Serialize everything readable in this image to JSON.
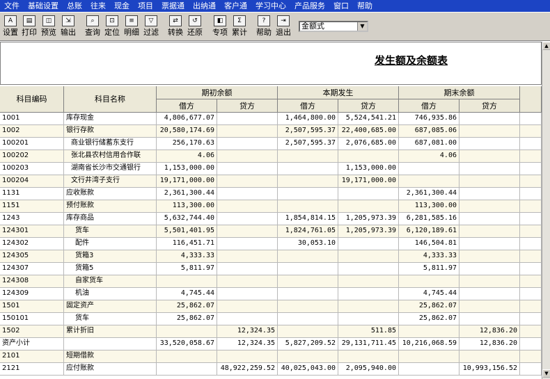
{
  "menu": [
    "文件",
    "基础设置",
    "总账",
    "往来",
    "现金",
    "项目",
    "票据通",
    "出纳通",
    "客户通",
    "学习中心",
    "产品服务",
    "窗口",
    "帮助"
  ],
  "toolbar": [
    {
      "label": "设置",
      "icon": "A",
      "name": "settings"
    },
    {
      "label": "打印",
      "icon": "▤",
      "name": "print"
    },
    {
      "label": "预览",
      "icon": "◫",
      "name": "preview"
    },
    {
      "label": "输出",
      "icon": "⇲",
      "name": "export"
    },
    {
      "label": "查询",
      "icon": "⌕",
      "name": "query"
    },
    {
      "label": "定位",
      "icon": "⊡",
      "name": "locate"
    },
    {
      "label": "明细",
      "icon": "≡",
      "name": "detail"
    },
    {
      "label": "过滤",
      "icon": "▽",
      "name": "filter"
    },
    {
      "label": "转换",
      "icon": "⇄",
      "name": "convert"
    },
    {
      "label": "还原",
      "icon": "↺",
      "name": "restore"
    },
    {
      "label": "专项",
      "icon": "◧",
      "name": "special"
    },
    {
      "label": "累计",
      "icon": "Σ",
      "name": "cumulative"
    },
    {
      "label": "帮助",
      "icon": "?",
      "name": "help"
    },
    {
      "label": "退出",
      "icon": "⇥",
      "name": "exit"
    }
  ],
  "format_select": "金额式",
  "report_title": "发生额及余额表",
  "headers": {
    "code": "科目编码",
    "name": "科目名称",
    "opening": "期初余额",
    "current": "本期发生",
    "closing": "期末余额",
    "debit": "借方",
    "credit": "贷方"
  },
  "rows": [
    {
      "code": "1001",
      "name": "库存现金",
      "lvl": 1,
      "od": "4,806,677.07",
      "oc": "",
      "cd": "1,464,800.00",
      "cc": "5,524,541.21",
      "ed": "746,935.86",
      "ec": ""
    },
    {
      "code": "1002",
      "name": "银行存款",
      "lvl": 1,
      "od": "20,580,174.69",
      "oc": "",
      "cd": "2,507,595.37",
      "cc": "22,400,685.00",
      "ed": "687,085.06",
      "ec": ""
    },
    {
      "code": "100201",
      "name": "商业银行储蓄东支行",
      "lvl": 2,
      "od": "256,170.63",
      "oc": "",
      "cd": "2,507,595.37",
      "cc": "2,076,685.00",
      "ed": "687,081.00",
      "ec": ""
    },
    {
      "code": "100202",
      "name": "张北县农村信用合作联",
      "lvl": 2,
      "od": "4.06",
      "oc": "",
      "cd": "",
      "cc": "",
      "ed": "4.06",
      "ec": ""
    },
    {
      "code": "100203",
      "name": "湖南省长沙市交通银行",
      "lvl": 2,
      "od": "1,153,000.00",
      "oc": "",
      "cd": "",
      "cc": "1,153,000.00",
      "ed": "",
      "ec": ""
    },
    {
      "code": "100204",
      "name": "文行井湾子支行",
      "lvl": 2,
      "od": "19,171,000.00",
      "oc": "",
      "cd": "",
      "cc": "19,171,000.00",
      "ed": "",
      "ec": ""
    },
    {
      "code": "1131",
      "name": "应收账款",
      "lvl": 1,
      "od": "2,361,300.44",
      "oc": "",
      "cd": "",
      "cc": "",
      "ed": "2,361,300.44",
      "ec": ""
    },
    {
      "code": "1151",
      "name": "预付账款",
      "lvl": 1,
      "od": "113,300.00",
      "oc": "",
      "cd": "",
      "cc": "",
      "ed": "113,300.00",
      "ec": ""
    },
    {
      "code": "1243",
      "name": "库存商品",
      "lvl": 1,
      "od": "5,632,744.40",
      "oc": "",
      "cd": "1,854,814.15",
      "cc": "1,205,973.39",
      "ed": "6,281,585.16",
      "ec": ""
    },
    {
      "code": "124301",
      "name": "货车",
      "lvl": 3,
      "od": "5,501,401.95",
      "oc": "",
      "cd": "1,824,761.05",
      "cc": "1,205,973.39",
      "ed": "6,120,189.61",
      "ec": ""
    },
    {
      "code": "124302",
      "name": "配件",
      "lvl": 3,
      "od": "116,451.71",
      "oc": "",
      "cd": "30,053.10",
      "cc": "",
      "ed": "146,504.81",
      "ec": ""
    },
    {
      "code": "124305",
      "name": "货箱3",
      "lvl": 3,
      "od": "4,333.33",
      "oc": "",
      "cd": "",
      "cc": "",
      "ed": "4,333.33",
      "ec": ""
    },
    {
      "code": "124307",
      "name": "货箱5",
      "lvl": 3,
      "od": "5,811.97",
      "oc": "",
      "cd": "",
      "cc": "",
      "ed": "5,811.97",
      "ec": ""
    },
    {
      "code": "124308",
      "name": "自家货车",
      "lvl": 3,
      "od": "",
      "oc": "",
      "cd": "",
      "cc": "",
      "ed": "",
      "ec": ""
    },
    {
      "code": "124309",
      "name": "机油",
      "lvl": 3,
      "od": "4,745.44",
      "oc": "",
      "cd": "",
      "cc": "",
      "ed": "4,745.44",
      "ec": ""
    },
    {
      "code": "1501",
      "name": "固定资产",
      "lvl": 1,
      "od": "25,862.07",
      "oc": "",
      "cd": "",
      "cc": "",
      "ed": "25,862.07",
      "ec": ""
    },
    {
      "code": "150101",
      "name": "货车",
      "lvl": 3,
      "od": "25,862.07",
      "oc": "",
      "cd": "",
      "cc": "",
      "ed": "25,862.07",
      "ec": ""
    },
    {
      "code": "1502",
      "name": "累计折旧",
      "lvl": 1,
      "od": "",
      "oc": "12,324.35",
      "cd": "",
      "cc": "511.85",
      "ed": "",
      "ec": "12,836.20"
    },
    {
      "code": "资产小计",
      "name": "",
      "lvl": 1,
      "od": "33,520,058.67",
      "oc": "12,324.35",
      "cd": "5,827,209.52",
      "cc": "29,131,711.45",
      "ed": "10,216,068.59",
      "ec": "12,836.20"
    },
    {
      "code": "2101",
      "name": "短期借款",
      "lvl": 1,
      "od": "",
      "oc": "",
      "cd": "",
      "cc": "",
      "ed": "",
      "ec": ""
    },
    {
      "code": "2121",
      "name": "应付账款",
      "lvl": 1,
      "od": "",
      "oc": "48,922,259.52",
      "cd": "40,025,043.00",
      "cc": "2,095,940.00",
      "ed": "",
      "ec": "10,993,156.52"
    }
  ],
  "colors": {
    "menubar": "#1c44c4",
    "toolbar": "#d4d0c8",
    "header": "#ece9d8",
    "row_alt": "#fbf8e8"
  }
}
